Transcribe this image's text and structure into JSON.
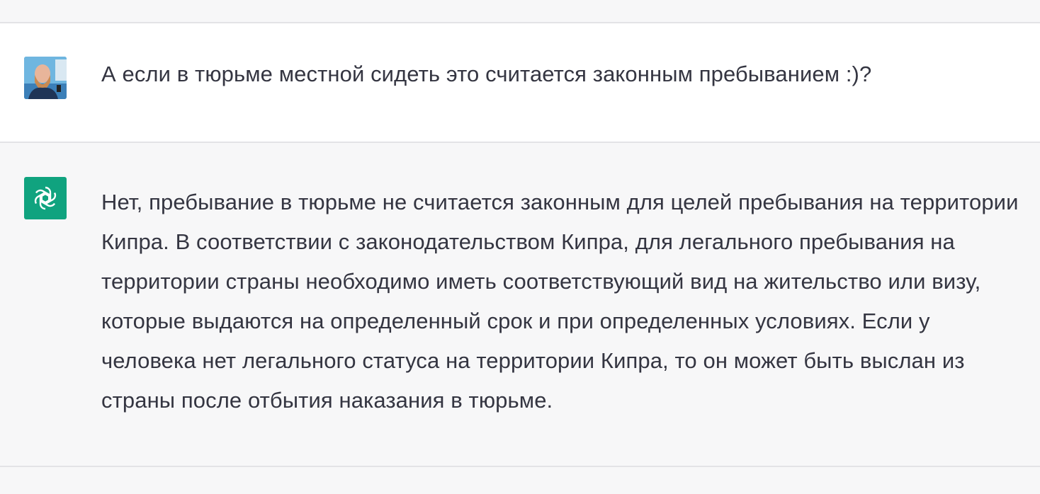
{
  "conversation": {
    "user_message": {
      "text": "А если в тюрьме местной сидеть это считается законным пребыванием :)?",
      "avatar_icon": "user-photo-avatar"
    },
    "assistant_message": {
      "text": "Нет, пребывание в тюрьме не считается законным для целей пребывания на территории Кипра. В соответствии с законодательством Кипра, для легального пребывания на территории страны необходимо иметь соответствующий вид на жительство или визу, которые выдаются на определенный срок и при определенных условиях. Если у человека нет легального статуса на территории Кипра, то он может быть выслан из страны после отбытия наказания в тюрьме.",
      "avatar_icon": "openai-logo-icon",
      "avatar_color": "#10a37f"
    }
  },
  "colors": {
    "text": "#343541",
    "assistant_bg": "#f7f7f8",
    "user_bg": "#ffffff",
    "divider": "#e3e3e6"
  }
}
